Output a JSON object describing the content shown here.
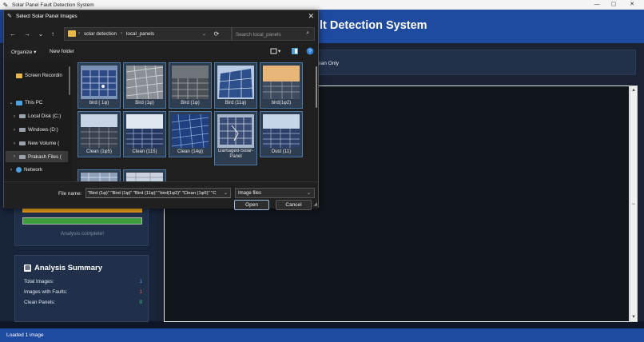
{
  "window": {
    "title": "Solar Panel Fault Detection System",
    "controls": {
      "minimize": "—",
      "maximize": "▢",
      "close": "✕"
    }
  },
  "header": {
    "title_visible": "lt Detection System"
  },
  "filter": {
    "visible_label": "ean Only"
  },
  "progress": {
    "status": "Analysis complete!",
    "fraction": 1.0
  },
  "summary": {
    "title": "Analysis Summary",
    "rows": [
      {
        "label": "Total Images:",
        "value": "1",
        "color": "#4aa3ff"
      },
      {
        "label": "Images with Faults:",
        "value": "1",
        "color": "#ff5a5a"
      },
      {
        "label": "Clean Panels:",
        "value": "0",
        "color": "#3ddc97"
      }
    ]
  },
  "status_bar": {
    "text": "Loaded 1 image"
  },
  "dialog": {
    "title": "Select Solar Panel Images",
    "close": "✕",
    "nav": {
      "back": "←",
      "forward": "→",
      "recent": "⌄",
      "up": "↑",
      "refresh": "⟳"
    },
    "path": [
      "solar detection",
      "local_panels"
    ],
    "search_placeholder": "Search local_panels",
    "toolbar": {
      "organize": "Organize ▾",
      "new_folder": "New folder"
    },
    "nav_pane": [
      {
        "label": "Screen Recordin",
        "icon": "folder-icon",
        "caret": ""
      },
      {
        "label": "This PC",
        "icon": "computer-icon",
        "caret": "⌄"
      },
      {
        "label": "Local Disk (C:)",
        "icon": "disk-icon",
        "caret": "›"
      },
      {
        "label": "Windows (D:)",
        "icon": "disk-icon",
        "caret": "›"
      },
      {
        "label": "New Volume (",
        "icon": "disk-icon",
        "caret": "›"
      },
      {
        "label": "Prakash Files (",
        "icon": "disk-icon",
        "caret": "›"
      },
      {
        "label": "Network",
        "icon": "network-icon",
        "caret": "›"
      }
    ],
    "files": [
      {
        "name": "bird ( 1φ)",
        "thumb": "dark-panel-blue"
      },
      {
        "name": "Bird (1φ)",
        "thumb": "gray-panel"
      },
      {
        "name": "Bird (1φ)",
        "thumb": "gray-panel-dark"
      },
      {
        "name": "Bird (11φ)",
        "thumb": "blue-panel-sky"
      },
      {
        "name": "bird(1φ2)",
        "thumb": "sunset-panel"
      },
      {
        "name": "Clean (1φ5)",
        "thumb": "clean-panel-sky"
      },
      {
        "name": "Clean (115)",
        "thumb": "clean-panel-row"
      },
      {
        "name": "Clean (14φ)",
        "thumb": "clean-panel-blue"
      },
      {
        "name": "Damaged-Solar-Panel",
        "thumb": "damaged-panel"
      },
      {
        "name": "Dust (11)",
        "thumb": "dust-panel"
      },
      {
        "name": "",
        "thumb": "partial-panel"
      },
      {
        "name": "",
        "thumb": "partial-panel-light"
      }
    ],
    "file_name_label": "File name:",
    "file_name_value": "\"Bird (1φ)\" \"Bird (1φ)\" \"Bird (11φ)\" \"bird(1φ2)\" \"Clean (1φ5)\" \"C",
    "file_type_value": "Image files",
    "open_label": "Open",
    "cancel_label": "Cancel"
  }
}
